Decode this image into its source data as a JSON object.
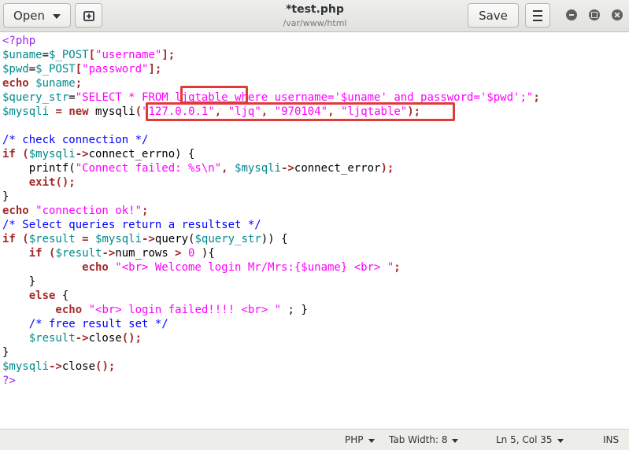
{
  "header": {
    "open_label": "Open",
    "save_label": "Save",
    "title": "*test.php",
    "subtitle": "/var/www/html"
  },
  "code": {
    "l1": "<?php",
    "l2_var": "$uname",
    "l2_op": "=",
    "l2_post": "$_POST",
    "l2_b1": "[",
    "l2_str": "\"username\"",
    "l2_b2": "];",
    "l3_var": "$pwd",
    "l3_op": "=",
    "l3_post": "$_POST",
    "l3_b1": "[",
    "l3_str": "\"password\"",
    "l3_b2": "];",
    "l4_kw": "echo",
    "l4_var": "$uname",
    "l4_end": ";",
    "l5_var": "$query_str",
    "l5_op": "=",
    "l5_str": "\"SELECT * FROM ljqtable where username='$uname' and password='$pwd';\"",
    "l5_end": ";",
    "l6_var": "$mysqli",
    "l6_op": " = ",
    "l6_new": "new",
    "l6_fn": " mysqli",
    "l6_p1": "(",
    "l6_a1": "\"127.0.0.1\"",
    "l6_c1": ", ",
    "l6_a2": "\"ljq\"",
    "l6_c2": ", ",
    "l6_a3": "\"970104\"",
    "l6_c3": ", ",
    "l6_a4": "\"ljqtable\"",
    "l6_p2": ");",
    "l8": "/* check connection */",
    "l9_kw": "if",
    "l9_p": " (",
    "l9_var": "$mysqli",
    "l9_arrow": "->",
    "l9_rest": "connect_errno) {",
    "l10_fn": "    printf(",
    "l10_str": "\"Connect failed: %s\\n\"",
    "l10_c": ", ",
    "l10_var": "$mysqli",
    "l10_arrow": "->",
    "l10_rest": "connect_error",
    "l10_end": ");",
    "l11_kw": "    exit",
    "l11_end": "();",
    "l12": "}",
    "l13_kw": "echo",
    "l13_str": " \"connection ok!\"",
    "l13_end": ";",
    "l14": "/* Select queries return a resultset */",
    "l15_kw": "if",
    "l15_p": " (",
    "l15_var1": "$result",
    "l15_op": " = ",
    "l15_var2": "$mysqli",
    "l15_arrow": "->",
    "l15_fn": "query(",
    "l15_var3": "$query_str",
    "l15_end": ")) {",
    "l16_kw": "    if",
    "l16_p": " (",
    "l16_var": "$result",
    "l16_arrow": "->",
    "l16_fn": "num_rows ",
    "l16_op": ">",
    "l16_num": " 0 ",
    "l16_end": "){",
    "l17_kw": "            echo",
    "l17_str": " \"<br> Welcome login Mr/Mrs:{$uname} <br> \"",
    "l17_end": ";",
    "l18": "    }",
    "l19_kw": "    else",
    "l19_end": " {",
    "l20_kw": "        echo",
    "l20_str": " \"<br> login failed!!!! <br> \"",
    "l20_end": " ; }",
    "l21": "    /* free result set */",
    "l22_var": "    $result",
    "l22_arrow": "->",
    "l22_fn": "close",
    "l22_end": "();",
    "l23": "}",
    "l24_var": "$mysqli",
    "l24_arrow": "->",
    "l24_fn": "close",
    "l24_end": "();",
    "l25": "?>"
  },
  "statusbar": {
    "language": "PHP",
    "tab_width": "Tab Width: 8",
    "position": "Ln 5, Col 35",
    "mode": "INS"
  },
  "colors": {
    "keyword": "#a52a2a",
    "variable": "#008a8c",
    "string": "#ff00ff",
    "comment": "#0000ff",
    "php_tag": "#a020f0",
    "highlight_box": "#e03b3b"
  }
}
